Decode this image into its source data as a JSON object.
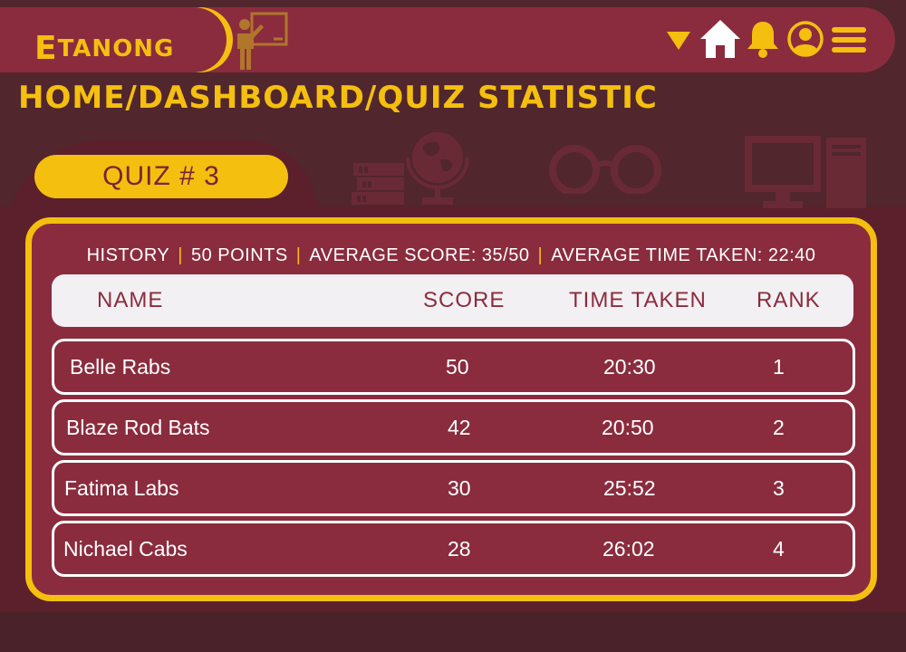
{
  "app": {
    "logo_first": "E",
    "logo_rest": "TANONG",
    "colors": {
      "accent": "#f4bf0f",
      "primary": "#8a2c3e",
      "background": "#51262d"
    }
  },
  "nav": {
    "icons": [
      "dropdown-arrow-icon",
      "home-icon",
      "bell-icon",
      "user-icon",
      "menu-icon"
    ]
  },
  "breadcrumb": "HOME/DASHBOARD/QUIZ STATISTIC",
  "quiz": {
    "title": "QUIZ # 3",
    "subject": "HISTORY",
    "points": "50 POINTS",
    "average_score": "AVERAGE SCORE: 35/50",
    "average_time": "AVERAGE TIME TAKEN: 22:40"
  },
  "table": {
    "headers": {
      "name": "NAME",
      "score": "SCORE",
      "time": "TIME TAKEN",
      "rank": "RANK"
    },
    "rows": [
      {
        "name": "Belle Rabs",
        "score": "50",
        "time": "20:30",
        "rank": "1"
      },
      {
        "name": "Blaze Rod Bats",
        "score": "42",
        "time": "20:50",
        "rank": "2"
      },
      {
        "name": "Fatima Labs",
        "score": "30",
        "time": "25:52",
        "rank": "3"
      },
      {
        "name": "Nichael Cabs",
        "score": "28",
        "time": "26:02",
        "rank": "4"
      }
    ]
  }
}
